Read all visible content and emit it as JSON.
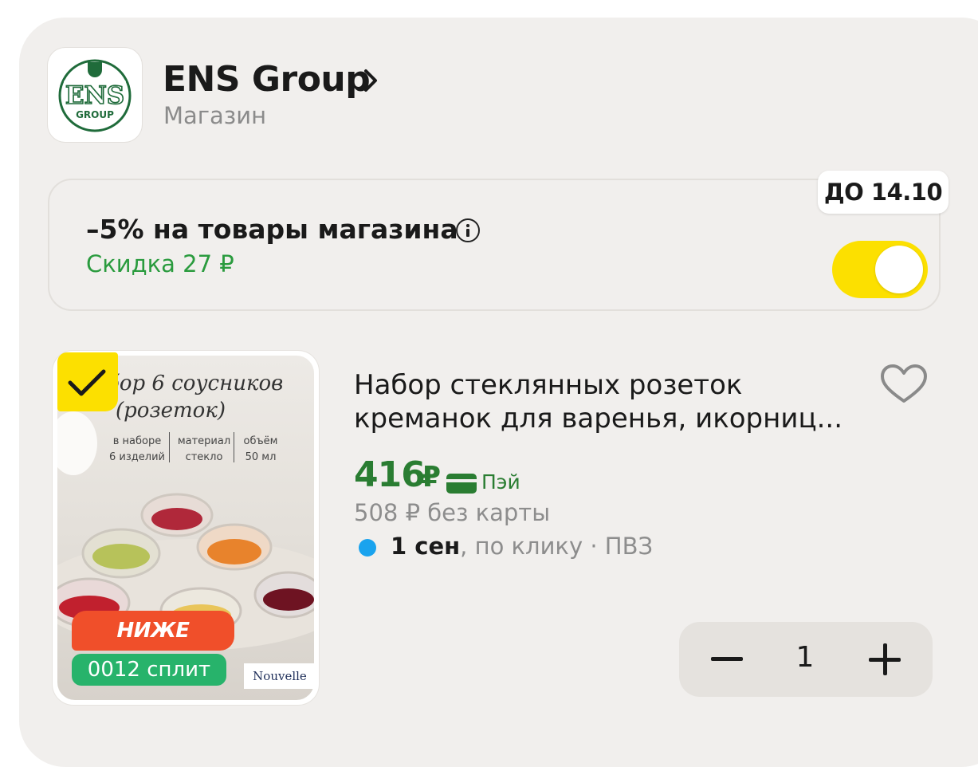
{
  "shop": {
    "name": "ENS Group",
    "type": "Магазин",
    "logo_text": "ENS",
    "logo_subtext": "GROUP"
  },
  "promo": {
    "title": "–5% на товары магазина",
    "discount": "Скидка 27 ₽",
    "deadline_badge": "ДО 14.10",
    "toggle_on": true
  },
  "product": {
    "image_title_line1": "бор 6 соусников",
    "image_title_line2": "(розеток)",
    "image_specs": [
      {
        "label": "в наборе",
        "value": "6 изделий"
      },
      {
        "label": "материал",
        "value": "стекло"
      },
      {
        "label": "объём",
        "value": "50 мл"
      }
    ],
    "image_brand": "Nouvelle",
    "badge_lower": "НИЖЕ РЫНКА",
    "badge_split": "0012 сплит",
    "selected": true,
    "title": "Набор стеклянных розеток креманок для варенья, икорниц...",
    "price": "416",
    "currency": "₽",
    "pay_label": "Пэй",
    "old_price": "508 ₽ без карты",
    "delivery_date": "1 сен",
    "delivery_rest": ", по клику · ПВЗ",
    "quantity": "1"
  },
  "colors": {
    "accent_yellow": "#fce000",
    "price_green": "#2a7d32",
    "discount_green": "#2a9b3e",
    "badge_red": "#f04f2a",
    "split_green": "#27b36b",
    "delivery_dot": "#1aa3ee"
  },
  "icons": [
    "chevron-right-icon",
    "info-icon",
    "heart-icon",
    "checkmark-icon",
    "card-icon",
    "minus-icon",
    "plus-icon"
  ]
}
